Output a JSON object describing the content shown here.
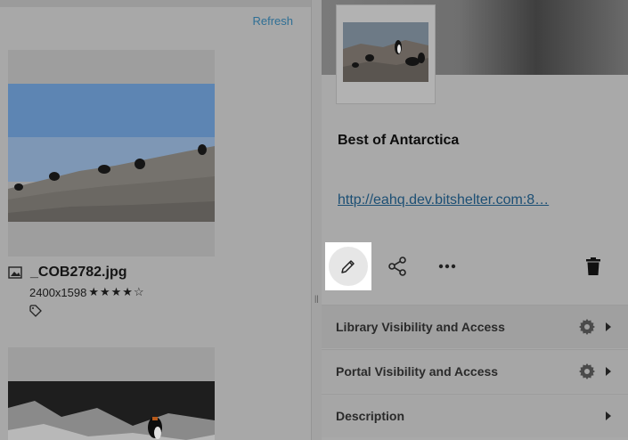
{
  "left_panel": {
    "refresh_label": "Refresh",
    "asset": {
      "file_name": "_COB2782.jpg",
      "dimensions": "2400x1598",
      "stars": "★★★★☆",
      "rating": 4,
      "rating_max": 5
    }
  },
  "right_panel": {
    "collection_title": "Best of Antarctica",
    "collection_url": "http://eahq.dev.bitshelter.com:8…",
    "actions": {
      "edit": "pencil-icon",
      "share": "share-icon",
      "more": "more-horizontal-icon",
      "delete": "trash-icon"
    },
    "sections": [
      {
        "label": "Library Visibility and Access",
        "has_gear": true
      },
      {
        "label": "Portal Visibility and Access",
        "has_gear": true
      },
      {
        "label": "Description",
        "has_gear": false
      }
    ]
  },
  "colors": {
    "link": "#2f6f95",
    "url": "#1c4f74",
    "overlay_bg": "#a9a9a9",
    "highlight": "#ffffff"
  }
}
